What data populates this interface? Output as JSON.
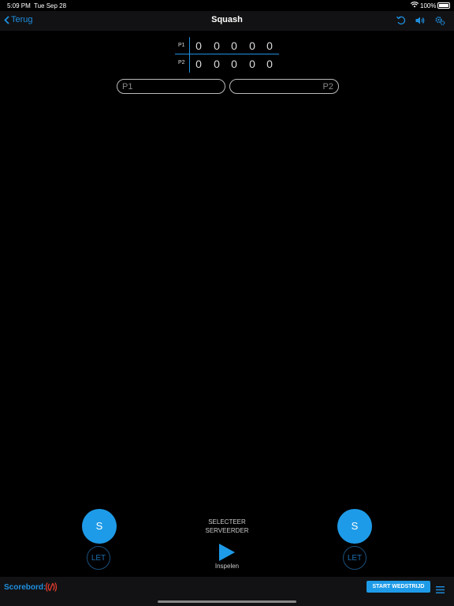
{
  "status": {
    "time": "5:09 PM",
    "date": "Tue Sep 28",
    "battery": "100%"
  },
  "nav": {
    "back_label": "Terug",
    "title": "Squash"
  },
  "scoreboard": {
    "players": [
      "P1",
      "P2"
    ],
    "p1_scores": [
      "0",
      "0",
      "0",
      "0",
      "0"
    ],
    "p2_scores": [
      "0",
      "0",
      "0",
      "0",
      "0"
    ]
  },
  "names": {
    "p1_placeholder": "P1",
    "p2_placeholder": "P2"
  },
  "controls": {
    "serve_left": "S",
    "serve_right": "S",
    "let_left": "LET",
    "let_right": "LET",
    "select_line1": "SELECTEER",
    "select_line2": "SERVEERDER",
    "play_label": "Inspelen"
  },
  "bottom": {
    "scorebord_label": "Scorebord:",
    "start_button": "START WEDSTRIJD"
  },
  "colors": {
    "accent": "#1e9be8",
    "alert": "#e03a2e",
    "background": "#000000"
  }
}
